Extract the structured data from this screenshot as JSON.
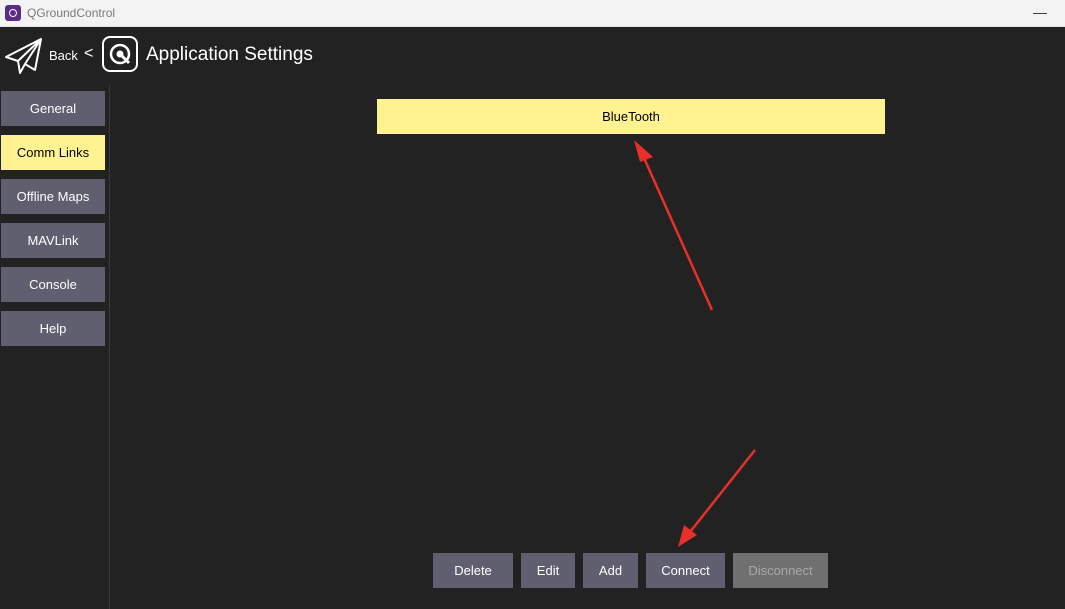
{
  "window": {
    "title": "QGroundControl",
    "minimize_glyph": "—"
  },
  "header": {
    "back_label": "Back",
    "back_chevron": "<",
    "title": "Application Settings"
  },
  "sidebar": {
    "items": [
      {
        "label": "General",
        "active": false
      },
      {
        "label": "Comm Links",
        "active": true
      },
      {
        "label": "Offline Maps",
        "active": false
      },
      {
        "label": "MAVLink",
        "active": false
      },
      {
        "label": "Console",
        "active": false
      },
      {
        "label": "Help",
        "active": false
      }
    ]
  },
  "links": {
    "items": [
      {
        "label": "BlueTooth",
        "selected": true
      }
    ]
  },
  "actions": {
    "delete": "Delete",
    "edit": "Edit",
    "add": "Add",
    "connect": "Connect",
    "disconnect": "Disconnect"
  },
  "colors": {
    "background": "#222222",
    "button": "#605f6f",
    "accent": "#fff291",
    "annotation_arrow": "#e8302a"
  },
  "icons": {
    "app": "qgc-app-icon",
    "plane": "paper-plane-icon",
    "logo": "qgc-logo-icon"
  }
}
